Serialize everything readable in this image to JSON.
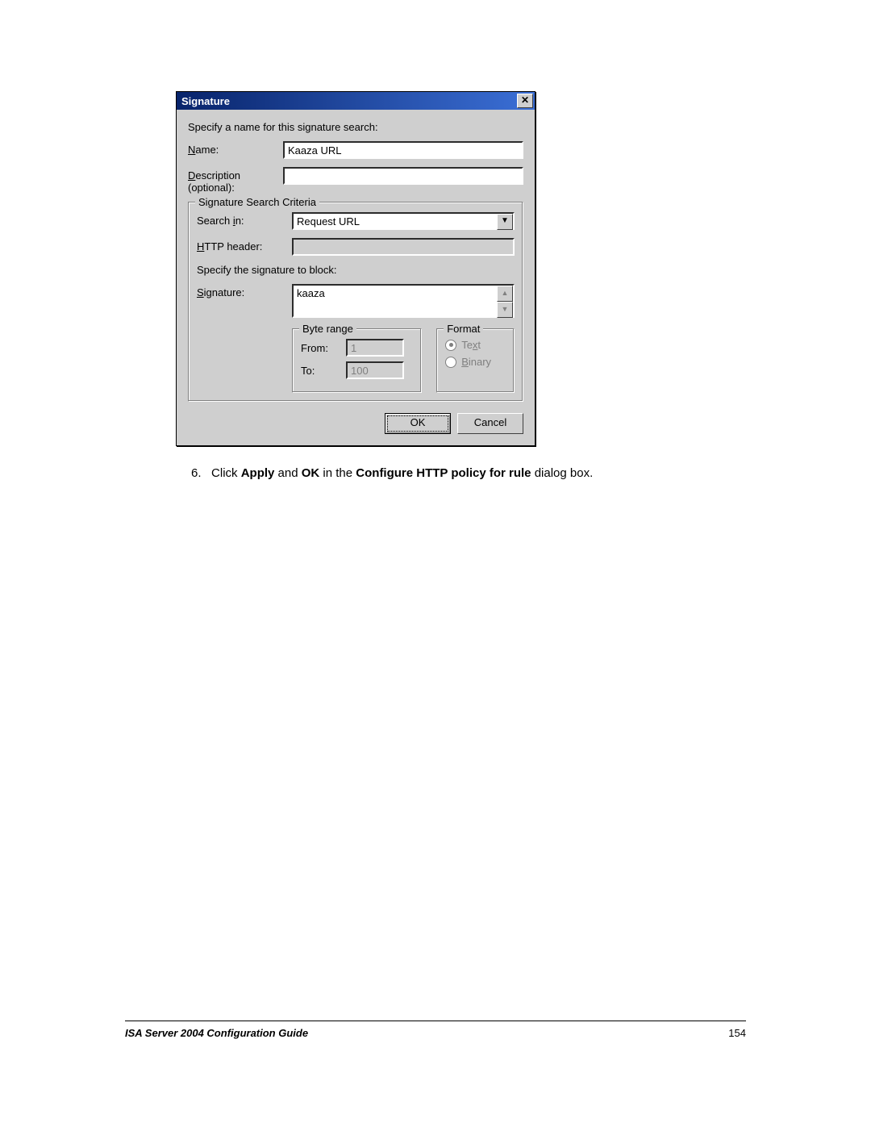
{
  "dialog": {
    "title": "Signature",
    "instruction": "Specify a name for this signature search:",
    "name_label_pre": "N",
    "name_label_post": "ame:",
    "name_value": "Kaaza URL",
    "desc_label_pre": "D",
    "desc_label_post": "escription (optional):",
    "desc_value": "",
    "criteria": {
      "legend": "Signature Search Criteria",
      "searchin_label_pre": "Search ",
      "searchin_label_mid": "i",
      "searchin_label_post": "n:",
      "searchin_value": "Request URL",
      "http_label_pre": "H",
      "http_label_post": "TTP header:",
      "http_value": "",
      "block_instruction": "Specify the signature to block:",
      "sig_label_pre": "S",
      "sig_label_post": "ignature:",
      "sig_value": "kaaza",
      "byte_range": {
        "legend": "Byte range",
        "from_label_pre": "F",
        "from_label_post": "rom:",
        "from_value": "1",
        "to_label_pre": "T",
        "to_label_post": "o:",
        "to_value": "100"
      },
      "format": {
        "legend": "Format",
        "text_label_pre": "Te",
        "text_label_mid": "x",
        "text_label_post": "t",
        "text_selected": true,
        "binary_label_pre": "B",
        "binary_label_post": "inary",
        "binary_selected": false
      }
    },
    "buttons": {
      "ok": "OK",
      "cancel": "Cancel"
    }
  },
  "step": {
    "num": "6.",
    "pre": "Click ",
    "b1": "Apply",
    "mid1": " and ",
    "b2": "OK",
    "mid2": " in the ",
    "b3": "Configure HTTP policy for rule",
    "post": " dialog box."
  },
  "footer": {
    "title": "ISA Server 2004 Configuration Guide",
    "page": "154"
  }
}
